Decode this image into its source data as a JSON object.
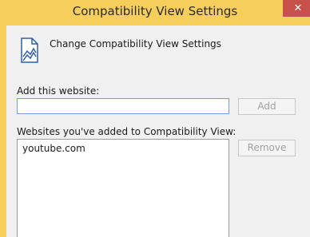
{
  "window": {
    "title": "Compatibility View Settings",
    "close_glyph": "✕"
  },
  "header": {
    "icon": "document-chart-icon",
    "text": "Change Compatibility View Settings"
  },
  "add_section": {
    "label": "Add this website:",
    "input_value": "",
    "add_button_label": "Add"
  },
  "list_section": {
    "label": "Websites you've added to Compatibility View:",
    "items": [
      "youtube.com"
    ],
    "remove_button_label": "Remove"
  },
  "colors": {
    "titlebar": "#f6ce5b",
    "close_button": "#c7504b",
    "dialog_bg": "#f0f0f0",
    "input_border": "#7a9ed4"
  }
}
